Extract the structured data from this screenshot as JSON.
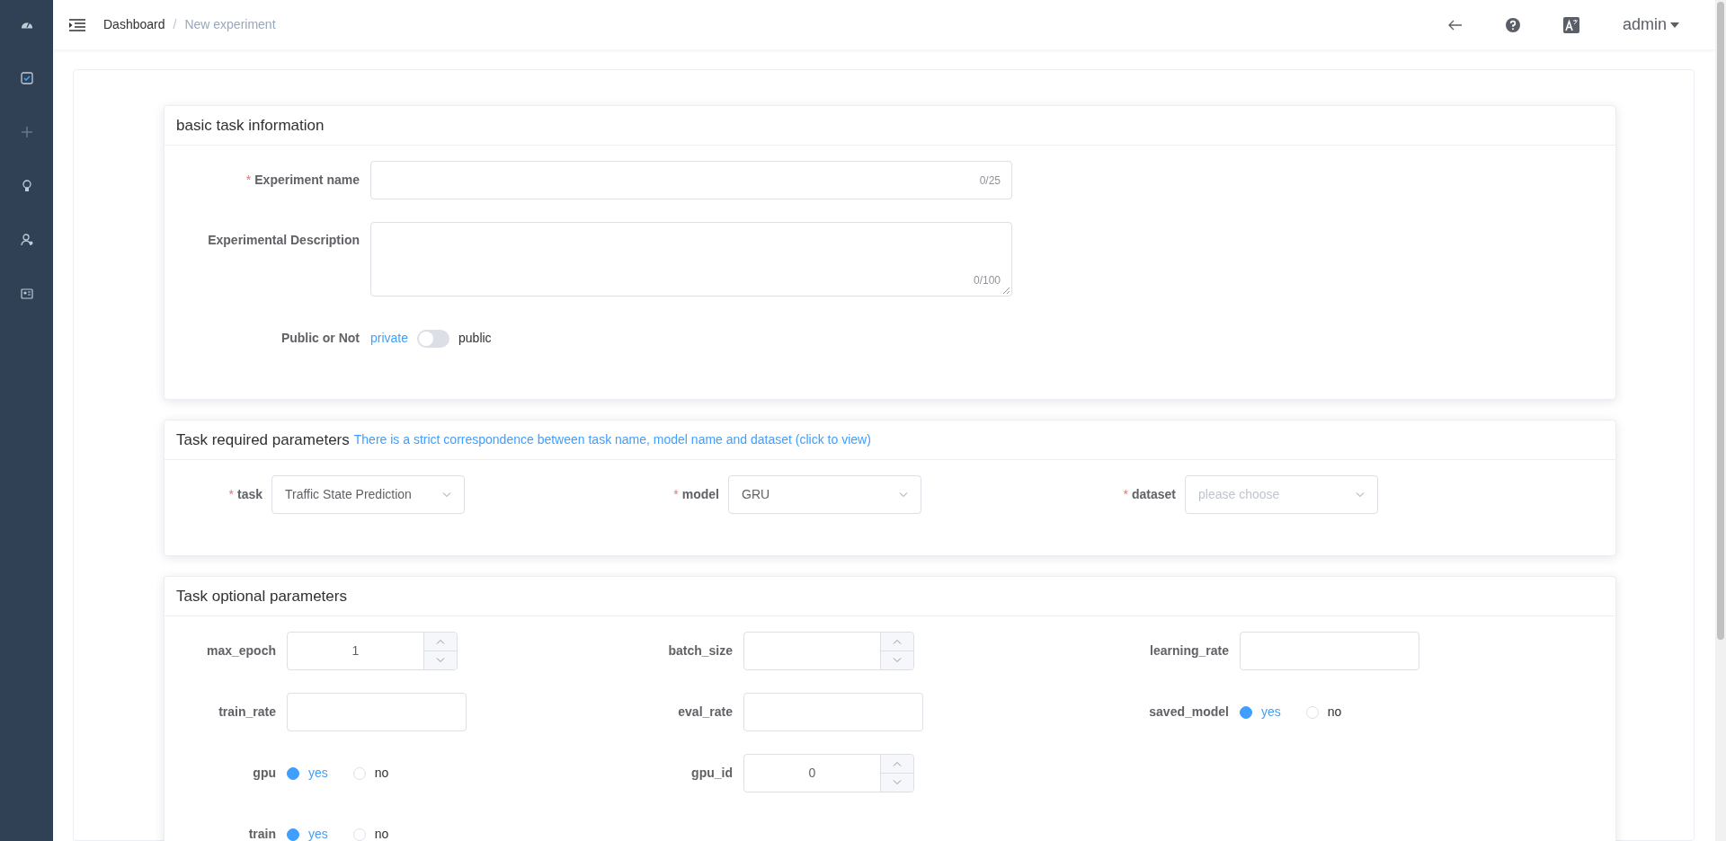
{
  "header": {
    "breadcrumb": [
      {
        "label": "Dashboard",
        "current": false
      },
      {
        "label": "New experiment",
        "current": true,
        "separator": "/"
      }
    ],
    "user": "admin"
  },
  "sections": [
    {
      "kind": "basic",
      "title": "basic task information",
      "rows": [
        [
          {
            "kind": "text",
            "label": "Experiment name",
            "required_mark": "*",
            "counter": "0/25"
          }
        ],
        [
          {
            "kind": "textarea",
            "label": "Experimental Description",
            "counter": "0/100"
          }
        ],
        [
          {
            "kind": "switch",
            "label": "Public or Not",
            "off_label": "private",
            "on_label": "public",
            "on": false
          }
        ]
      ]
    },
    {
      "kind": "required",
      "title": "Task required parameters",
      "link": "There is a strict correspondence between task name, model name and dataset (click to view)",
      "rows": [
        [
          {
            "kind": "select",
            "label": "task",
            "required_mark": "*",
            "value": "Traffic State Prediction"
          },
          {
            "kind": "select",
            "label": "model",
            "required_mark": "*",
            "value": "GRU"
          },
          {
            "kind": "select",
            "label": "dataset",
            "required_mark": "*",
            "placeholder": "please choose"
          }
        ]
      ]
    },
    {
      "kind": "optional",
      "title": "Task optional parameters",
      "rows": [
        [
          {
            "kind": "number",
            "label": "max_epoch",
            "value": "1"
          },
          {
            "kind": "number",
            "label": "batch_size"
          },
          {
            "kind": "text",
            "label": "learning_rate"
          }
        ],
        [
          {
            "kind": "text",
            "label": "train_rate"
          },
          {
            "kind": "text",
            "label": "eval_rate"
          },
          {
            "kind": "radio",
            "label": "saved_model",
            "options": [
              {
                "label": "yes",
                "selected": true
              },
              {
                "label": "no",
                "selected": false
              }
            ]
          }
        ],
        [
          {
            "kind": "radio",
            "label": "gpu",
            "options": [
              {
                "label": "yes",
                "selected": true
              },
              {
                "label": "no",
                "selected": false
              }
            ]
          },
          {
            "kind": "number",
            "label": "gpu_id",
            "value": "0"
          }
        ],
        [
          {
            "kind": "radio",
            "label": "train",
            "options": [
              {
                "label": "yes",
                "selected": true
              },
              {
                "label": "no",
                "selected": false
              }
            ]
          }
        ]
      ]
    }
  ]
}
